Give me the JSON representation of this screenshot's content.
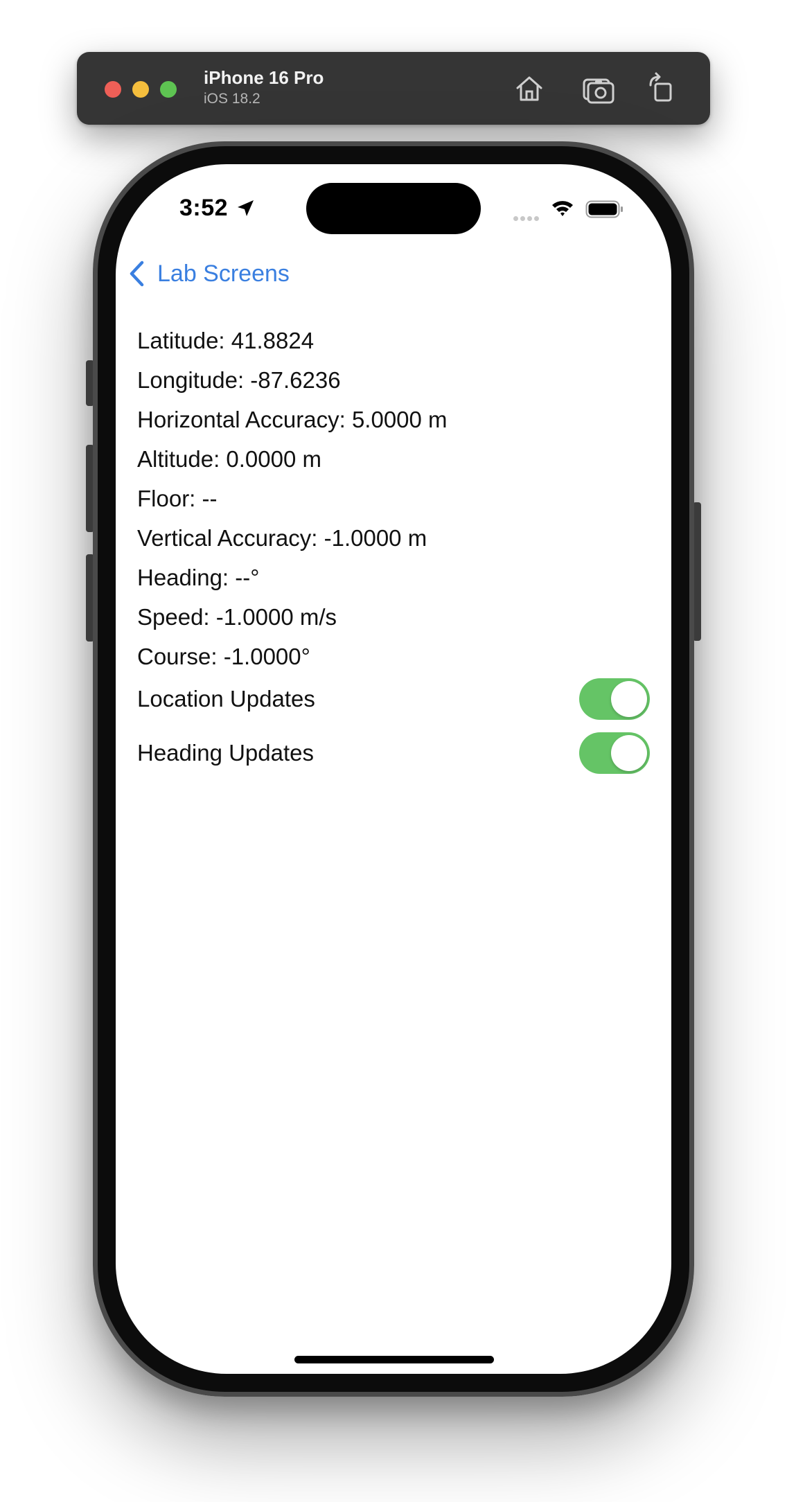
{
  "simulator": {
    "device_name": "iPhone 16 Pro",
    "os_version": "iOS 18.2",
    "toolbar_icons": [
      "home-icon",
      "screenshot-icon",
      "rotate-icon"
    ]
  },
  "status_bar": {
    "time": "3:52",
    "icons": [
      "location-arrow-icon",
      "cellular-icon",
      "wifi-icon",
      "battery-icon"
    ]
  },
  "nav": {
    "back_label": "Lab Screens",
    "accent_color": "#3a7fe0"
  },
  "location_info": [
    "Latitude: 41.8824",
    "Longitude: -87.6236",
    "Horizontal Accuracy: 5.0000 m",
    "Altitude: 0.0000 m",
    "Floor: --",
    "Vertical Accuracy: -1.0000 m",
    "Heading: --°",
    "Speed: -1.0000 m/s",
    "Course: -1.0000°"
  ],
  "toggles": {
    "location_updates": {
      "label": "Location Updates",
      "on": true
    },
    "heading_updates": {
      "label": "Heading Updates",
      "on": true
    },
    "on_color": "#65c466"
  }
}
